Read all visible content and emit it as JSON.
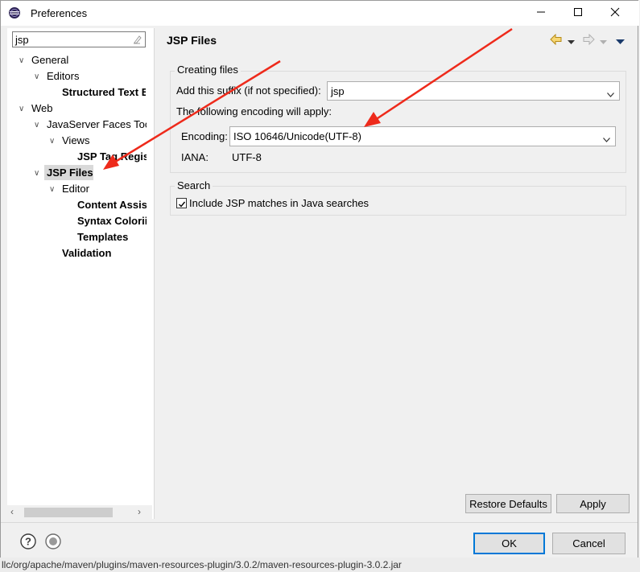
{
  "window": {
    "title": "Preferences"
  },
  "filter": {
    "value": "jsp"
  },
  "tree": {
    "general": "General",
    "editors": "Editors",
    "structured_text": "Structured Text E",
    "web": "Web",
    "jsf_tools": "JavaServer Faces Toc",
    "views": "Views",
    "jsp_tag": "JSP Tag Regis",
    "jsp_files": "JSP Files",
    "editor": "Editor",
    "content_assist": "Content Assis",
    "syntax_coloring": "Syntax Colorii",
    "templates": "Templates",
    "validation": "Validation"
  },
  "page": {
    "title": "JSP Files",
    "creating_files": {
      "legend": "Creating files",
      "suffix_label": "Add this suffix (if not specified):",
      "suffix_value": "jsp",
      "encoding_note": "The following encoding will apply:",
      "encoding_label": "Encoding:",
      "encoding_value": "ISO 10646/Unicode(UTF-8)",
      "iana_label": "IANA:",
      "iana_value": "UTF-8"
    },
    "search": {
      "legend": "Search",
      "checkbox_label": "Include JSP matches in Java searches",
      "checked": true
    }
  },
  "buttons": {
    "restore_defaults": "Restore Defaults",
    "apply": "Apply",
    "ok": "OK",
    "cancel": "Cancel"
  },
  "status_bar": {
    "text": "llc/org/apache/maven/plugins/maven-resources-plugin/3.0.2/maven-resources-plugin-3.0.2.jar"
  },
  "colors": {
    "annotation_arrow": "#ee2a1b",
    "selection": "#d9d9d9",
    "ok_border": "#0078d7"
  },
  "icons": [
    "eclipse-icon",
    "minimize-icon",
    "maximize-icon",
    "close-icon",
    "clear-filter-icon",
    "back-icon",
    "forward-icon",
    "view-menu-icon",
    "help-icon",
    "preferences-icon",
    "chevron-down-icon",
    "checkbox-checked-icon"
  ]
}
